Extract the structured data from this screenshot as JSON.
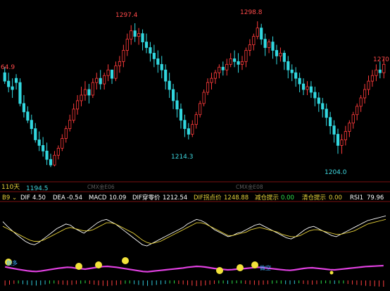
{
  "chart_data": [
    {
      "type": "candlestick",
      "price_labels": {
        "left_edge": "64.9",
        "high_1": "1297.4",
        "high_2": "1298.8",
        "right_edge": "1270",
        "low_1": "1194.5",
        "low_2": "1214.3",
        "low_3": "1204.0"
      },
      "period_label": "110天",
      "faint_labels": [
        "CMX金E06",
        "CMX金E08"
      ],
      "ylim": [
        1185,
        1310
      ],
      "candles": [
        [
          1262,
          1266,
          1256,
          1254
        ],
        [
          1256,
          1262,
          1252,
          1248
        ],
        [
          1252,
          1258,
          1250,
          1244
        ],
        [
          1258,
          1261,
          1255,
          1250
        ],
        [
          1255,
          1258,
          1240,
          1238
        ],
        [
          1240,
          1246,
          1234,
          1230
        ],
        [
          1234,
          1238,
          1228,
          1226
        ],
        [
          1228,
          1232,
          1222,
          1218
        ],
        [
          1222,
          1226,
          1214,
          1212
        ],
        [
          1214,
          1220,
          1210,
          1206
        ],
        [
          1210,
          1216,
          1206,
          1202
        ],
        [
          1206,
          1212,
          1200,
          1196
        ],
        [
          1200,
          1204,
          1196,
          1194.5
        ],
        [
          1196,
          1206,
          1203,
          1195
        ],
        [
          1203,
          1210,
          1208,
          1200
        ],
        [
          1208,
          1218,
          1215,
          1206
        ],
        [
          1215,
          1224,
          1222,
          1212
        ],
        [
          1222,
          1232,
          1228,
          1220
        ],
        [
          1228,
          1240,
          1236,
          1226
        ],
        [
          1236,
          1246,
          1242,
          1232
        ],
        [
          1242,
          1252,
          1246,
          1238
        ],
        [
          1246,
          1256,
          1250,
          1242
        ],
        [
          1250,
          1254,
          1246,
          1240
        ],
        [
          1246,
          1258,
          1255,
          1244
        ],
        [
          1255,
          1262,
          1258,
          1250
        ],
        [
          1258,
          1264,
          1254,
          1250
        ],
        [
          1254,
          1262,
          1260,
          1250
        ],
        [
          1260,
          1268,
          1264,
          1256
        ],
        [
          1264,
          1262,
          1258,
          1254
        ],
        [
          1258,
          1270,
          1267,
          1256
        ],
        [
          1267,
          1274,
          1270,
          1262
        ],
        [
          1270,
          1282,
          1278,
          1266
        ],
        [
          1278,
          1290,
          1286,
          1274
        ],
        [
          1286,
          1296,
          1292,
          1282
        ],
        [
          1292,
          1297.4,
          1288,
          1284
        ],
        [
          1288,
          1294,
          1290,
          1282
        ],
        [
          1290,
          1293,
          1284,
          1278
        ],
        [
          1284,
          1290,
          1280,
          1276
        ],
        [
          1280,
          1284,
          1276,
          1270
        ],
        [
          1276,
          1282,
          1272,
          1266
        ],
        [
          1272,
          1278,
          1268,
          1262
        ],
        [
          1268,
          1274,
          1264,
          1258
        ],
        [
          1264,
          1268,
          1256,
          1250
        ],
        [
          1256,
          1262,
          1250,
          1244
        ],
        [
          1250,
          1254,
          1242,
          1236
        ],
        [
          1242,
          1248,
          1236,
          1230
        ],
        [
          1236,
          1240,
          1228,
          1222
        ],
        [
          1228,
          1232,
          1222,
          1216
        ],
        [
          1222,
          1226,
          1218,
          1214.3
        ],
        [
          1218,
          1228,
          1225,
          1216
        ],
        [
          1225,
          1234,
          1232,
          1222
        ],
        [
          1232,
          1242,
          1240,
          1230
        ],
        [
          1240,
          1250,
          1248,
          1238
        ],
        [
          1248,
          1258,
          1255,
          1246
        ],
        [
          1255,
          1262,
          1258,
          1250
        ],
        [
          1258,
          1264,
          1262,
          1254
        ],
        [
          1262,
          1268,
          1266,
          1258
        ],
        [
          1266,
          1270,
          1264,
          1260
        ],
        [
          1264,
          1272,
          1268,
          1260
        ],
        [
          1268,
          1276,
          1272,
          1266
        ],
        [
          1272,
          1278,
          1270,
          1266
        ],
        [
          1270,
          1276,
          1268,
          1262
        ],
        [
          1268,
          1274,
          1270,
          1264
        ],
        [
          1270,
          1280,
          1278,
          1266
        ],
        [
          1278,
          1286,
          1282,
          1274
        ],
        [
          1282,
          1290,
          1288,
          1278
        ],
        [
          1288,
          1298.8,
          1294,
          1286
        ],
        [
          1294,
          1297,
          1286,
          1282
        ],
        [
          1286,
          1290,
          1280,
          1274
        ],
        [
          1280,
          1286,
          1284,
          1276
        ],
        [
          1284,
          1288,
          1278,
          1272
        ],
        [
          1278,
          1282,
          1274,
          1268
        ],
        [
          1274,
          1280,
          1276,
          1270
        ],
        [
          1276,
          1278,
          1270,
          1264
        ],
        [
          1270,
          1274,
          1264,
          1258
        ],
        [
          1264,
          1268,
          1262,
          1256
        ],
        [
          1262,
          1266,
          1258,
          1252
        ],
        [
          1258,
          1262,
          1254,
          1248
        ],
        [
          1254,
          1258,
          1250,
          1246
        ],
        [
          1250,
          1256,
          1252,
          1246
        ],
        [
          1252,
          1256,
          1248,
          1244
        ],
        [
          1248,
          1252,
          1244,
          1238
        ],
        [
          1244,
          1248,
          1240,
          1234
        ],
        [
          1240,
          1244,
          1236,
          1230
        ],
        [
          1236,
          1240,
          1230,
          1224
        ],
        [
          1230,
          1234,
          1224,
          1218
        ],
        [
          1224,
          1228,
          1218,
          1212
        ],
        [
          1218,
          1222,
          1210,
          1204
        ],
        [
          1210,
          1218,
          1214,
          1204
        ],
        [
          1214,
          1224,
          1220,
          1210
        ],
        [
          1220,
          1228,
          1226,
          1216
        ],
        [
          1226,
          1234,
          1232,
          1222
        ],
        [
          1232,
          1240,
          1238,
          1228
        ],
        [
          1238,
          1246,
          1244,
          1234
        ],
        [
          1244,
          1254,
          1250,
          1240
        ],
        [
          1250,
          1260,
          1256,
          1246
        ],
        [
          1256,
          1264,
          1260,
          1252
        ],
        [
          1260,
          1268,
          1264,
          1256
        ],
        [
          1264,
          1270,
          1262,
          1258
        ],
        [
          1262,
          1272,
          1268,
          1258
        ]
      ]
    },
    {
      "type": "line",
      "legend": [
        {
          "label": "B9",
          "value": ""
        },
        {
          "label": "DIF",
          "value": "4.50"
        },
        {
          "label": "DEA",
          "value": "-0.54"
        },
        {
          "label": "MACD",
          "value": "10.09"
        },
        {
          "label": "DIF穿零价",
          "value": "1212.54"
        },
        {
          "label": "DIF拐点价",
          "value": "1248.88"
        },
        {
          "label": "减仓提示",
          "value": "0.00"
        },
        {
          "label": "清仓提示",
          "value": "0.00"
        },
        {
          "label": "RSI1",
          "value": "79.96"
        }
      ],
      "overlay_labels": [
        "做多",
        "做空"
      ],
      "series": [
        {
          "name": "RSI1",
          "values": [
            70,
            62,
            55,
            48,
            42,
            36,
            32,
            30,
            34,
            40,
            46,
            52,
            58,
            62,
            66,
            64,
            58,
            54,
            50,
            56,
            62,
            68,
            72,
            74,
            70,
            66,
            60,
            54,
            48,
            42,
            36,
            30,
            28,
            32,
            36,
            40,
            44,
            48,
            52,
            56,
            60,
            66,
            70,
            74,
            72,
            68,
            62,
            56,
            52,
            48,
            44,
            46,
            50,
            52,
            56,
            60,
            64,
            66,
            62,
            58,
            54,
            50,
            46,
            42,
            40,
            44,
            50,
            56,
            60,
            62,
            58,
            54,
            50,
            46,
            44,
            48,
            52,
            56,
            60,
            64,
            68,
            72,
            74,
            76,
            78,
            80
          ]
        },
        {
          "values": [
            62,
            58,
            54,
            50,
            46,
            42,
            38,
            36,
            36,
            38,
            42,
            46,
            50,
            54,
            58,
            60,
            58,
            56,
            54,
            54,
            56,
            60,
            64,
            68,
            68,
            66,
            62,
            58,
            54,
            50,
            44,
            38,
            34,
            32,
            34,
            36,
            40,
            44,
            48,
            52,
            56,
            60,
            64,
            68,
            68,
            66,
            62,
            58,
            54,
            50,
            46,
            46,
            48,
            50,
            52,
            56,
            58,
            60,
            58,
            56,
            54,
            52,
            48,
            46,
            44,
            44,
            46,
            50,
            54,
            56,
            56,
            54,
            52,
            50,
            48,
            48,
            50,
            52,
            54,
            58,
            62,
            66,
            68,
            70,
            72,
            74
          ]
        }
      ]
    }
  ]
}
